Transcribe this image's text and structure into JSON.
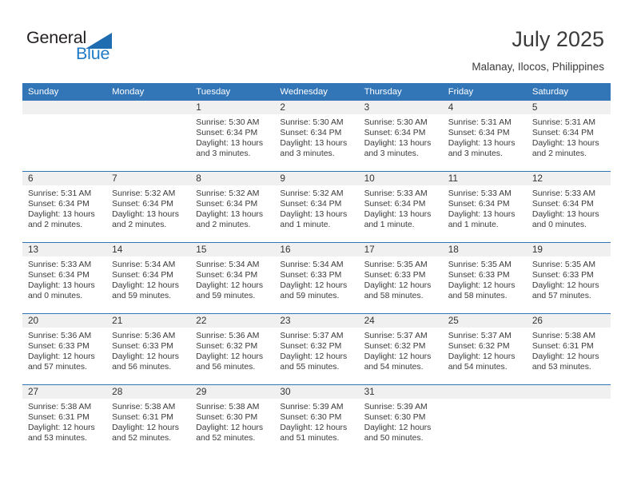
{
  "brand": {
    "name_part1": "General",
    "name_part2": "Blue",
    "triangle_color": "#1f6cb0",
    "blue_color": "#1f7ac6"
  },
  "header": {
    "title": "July 2025",
    "location": "Malanay, Ilocos, Philippines"
  },
  "theme": {
    "header_bg": "#3276b8",
    "daynum_bg": "#f0f0f0",
    "divider": "#3276b8",
    "text": "#3a3a3a"
  },
  "calendar": {
    "weekday_headers": [
      "Sunday",
      "Monday",
      "Tuesday",
      "Wednesday",
      "Thursday",
      "Friday",
      "Saturday"
    ],
    "labels": {
      "sunrise": "Sunrise:",
      "sunset": "Sunset:",
      "daylight": "Daylight:"
    },
    "weeks": [
      [
        {
          "day": "",
          "sunrise": "",
          "sunset": "",
          "daylight": "",
          "empty": true
        },
        {
          "day": "",
          "sunrise": "",
          "sunset": "",
          "daylight": "",
          "empty": true
        },
        {
          "day": "1",
          "sunrise": "Sunrise: 5:30 AM",
          "sunset": "Sunset: 6:34 PM",
          "daylight": "Daylight: 13 hours and 3 minutes."
        },
        {
          "day": "2",
          "sunrise": "Sunrise: 5:30 AM",
          "sunset": "Sunset: 6:34 PM",
          "daylight": "Daylight: 13 hours and 3 minutes."
        },
        {
          "day": "3",
          "sunrise": "Sunrise: 5:30 AM",
          "sunset": "Sunset: 6:34 PM",
          "daylight": "Daylight: 13 hours and 3 minutes."
        },
        {
          "day": "4",
          "sunrise": "Sunrise: 5:31 AM",
          "sunset": "Sunset: 6:34 PM",
          "daylight": "Daylight: 13 hours and 3 minutes."
        },
        {
          "day": "5",
          "sunrise": "Sunrise: 5:31 AM",
          "sunset": "Sunset: 6:34 PM",
          "daylight": "Daylight: 13 hours and 2 minutes."
        }
      ],
      [
        {
          "day": "6",
          "sunrise": "Sunrise: 5:31 AM",
          "sunset": "Sunset: 6:34 PM",
          "daylight": "Daylight: 13 hours and 2 minutes."
        },
        {
          "day": "7",
          "sunrise": "Sunrise: 5:32 AM",
          "sunset": "Sunset: 6:34 PM",
          "daylight": "Daylight: 13 hours and 2 minutes."
        },
        {
          "day": "8",
          "sunrise": "Sunrise: 5:32 AM",
          "sunset": "Sunset: 6:34 PM",
          "daylight": "Daylight: 13 hours and 2 minutes."
        },
        {
          "day": "9",
          "sunrise": "Sunrise: 5:32 AM",
          "sunset": "Sunset: 6:34 PM",
          "daylight": "Daylight: 13 hours and 1 minute."
        },
        {
          "day": "10",
          "sunrise": "Sunrise: 5:33 AM",
          "sunset": "Sunset: 6:34 PM",
          "daylight": "Daylight: 13 hours and 1 minute."
        },
        {
          "day": "11",
          "sunrise": "Sunrise: 5:33 AM",
          "sunset": "Sunset: 6:34 PM",
          "daylight": "Daylight: 13 hours and 1 minute."
        },
        {
          "day": "12",
          "sunrise": "Sunrise: 5:33 AM",
          "sunset": "Sunset: 6:34 PM",
          "daylight": "Daylight: 13 hours and 0 minutes."
        }
      ],
      [
        {
          "day": "13",
          "sunrise": "Sunrise: 5:33 AM",
          "sunset": "Sunset: 6:34 PM",
          "daylight": "Daylight: 13 hours and 0 minutes."
        },
        {
          "day": "14",
          "sunrise": "Sunrise: 5:34 AM",
          "sunset": "Sunset: 6:34 PM",
          "daylight": "Daylight: 12 hours and 59 minutes."
        },
        {
          "day": "15",
          "sunrise": "Sunrise: 5:34 AM",
          "sunset": "Sunset: 6:34 PM",
          "daylight": "Daylight: 12 hours and 59 minutes."
        },
        {
          "day": "16",
          "sunrise": "Sunrise: 5:34 AM",
          "sunset": "Sunset: 6:33 PM",
          "daylight": "Daylight: 12 hours and 59 minutes."
        },
        {
          "day": "17",
          "sunrise": "Sunrise: 5:35 AM",
          "sunset": "Sunset: 6:33 PM",
          "daylight": "Daylight: 12 hours and 58 minutes."
        },
        {
          "day": "18",
          "sunrise": "Sunrise: 5:35 AM",
          "sunset": "Sunset: 6:33 PM",
          "daylight": "Daylight: 12 hours and 58 minutes."
        },
        {
          "day": "19",
          "sunrise": "Sunrise: 5:35 AM",
          "sunset": "Sunset: 6:33 PM",
          "daylight": "Daylight: 12 hours and 57 minutes."
        }
      ],
      [
        {
          "day": "20",
          "sunrise": "Sunrise: 5:36 AM",
          "sunset": "Sunset: 6:33 PM",
          "daylight": "Daylight: 12 hours and 57 minutes."
        },
        {
          "day": "21",
          "sunrise": "Sunrise: 5:36 AM",
          "sunset": "Sunset: 6:33 PM",
          "daylight": "Daylight: 12 hours and 56 minutes."
        },
        {
          "day": "22",
          "sunrise": "Sunrise: 5:36 AM",
          "sunset": "Sunset: 6:32 PM",
          "daylight": "Daylight: 12 hours and 56 minutes."
        },
        {
          "day": "23",
          "sunrise": "Sunrise: 5:37 AM",
          "sunset": "Sunset: 6:32 PM",
          "daylight": "Daylight: 12 hours and 55 minutes."
        },
        {
          "day": "24",
          "sunrise": "Sunrise: 5:37 AM",
          "sunset": "Sunset: 6:32 PM",
          "daylight": "Daylight: 12 hours and 54 minutes."
        },
        {
          "day": "25",
          "sunrise": "Sunrise: 5:37 AM",
          "sunset": "Sunset: 6:32 PM",
          "daylight": "Daylight: 12 hours and 54 minutes."
        },
        {
          "day": "26",
          "sunrise": "Sunrise: 5:38 AM",
          "sunset": "Sunset: 6:31 PM",
          "daylight": "Daylight: 12 hours and 53 minutes."
        }
      ],
      [
        {
          "day": "27",
          "sunrise": "Sunrise: 5:38 AM",
          "sunset": "Sunset: 6:31 PM",
          "daylight": "Daylight: 12 hours and 53 minutes."
        },
        {
          "day": "28",
          "sunrise": "Sunrise: 5:38 AM",
          "sunset": "Sunset: 6:31 PM",
          "daylight": "Daylight: 12 hours and 52 minutes."
        },
        {
          "day": "29",
          "sunrise": "Sunrise: 5:38 AM",
          "sunset": "Sunset: 6:30 PM",
          "daylight": "Daylight: 12 hours and 52 minutes."
        },
        {
          "day": "30",
          "sunrise": "Sunrise: 5:39 AM",
          "sunset": "Sunset: 6:30 PM",
          "daylight": "Daylight: 12 hours and 51 minutes."
        },
        {
          "day": "31",
          "sunrise": "Sunrise: 5:39 AM",
          "sunset": "Sunset: 6:30 PM",
          "daylight": "Daylight: 12 hours and 50 minutes."
        },
        {
          "day": "",
          "sunrise": "",
          "sunset": "",
          "daylight": "",
          "empty": true
        },
        {
          "day": "",
          "sunrise": "",
          "sunset": "",
          "daylight": "",
          "empty": true
        }
      ]
    ]
  }
}
